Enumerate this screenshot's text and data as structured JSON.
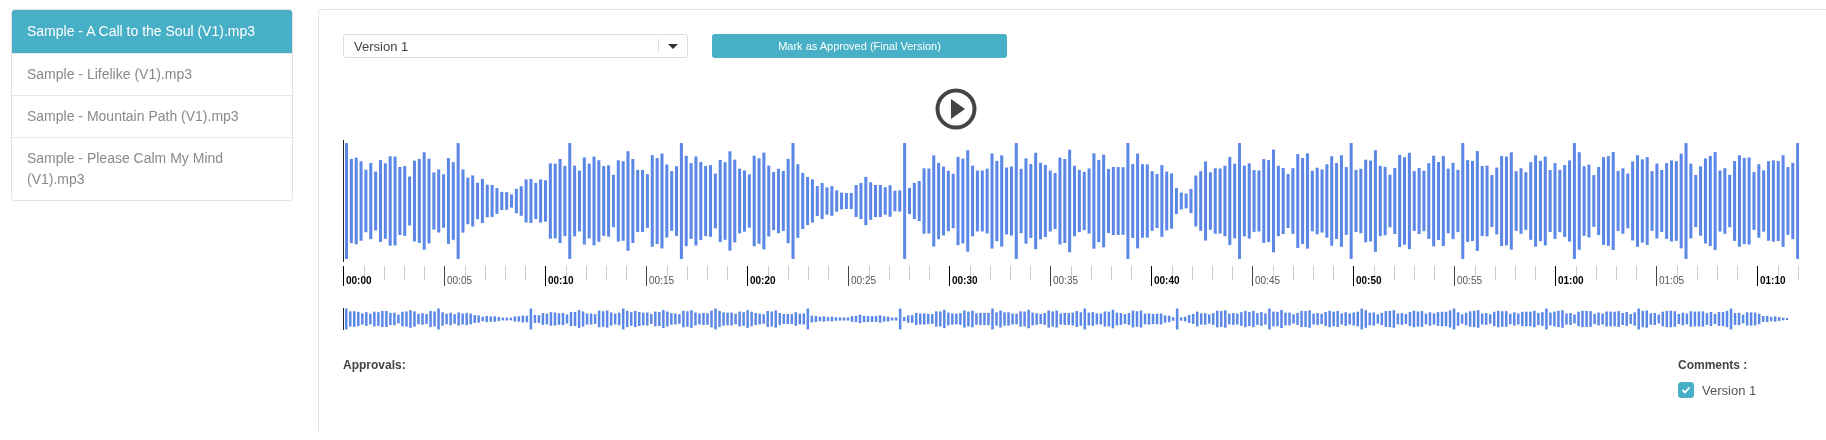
{
  "sidebar": {
    "items": [
      {
        "label": "Sample - A Call to the Soul (V1).mp3",
        "selected": true
      },
      {
        "label": "Sample - Lifelike (V1).mp3",
        "selected": false
      },
      {
        "label": "Sample - Mountain Path (V1).mp3",
        "selected": false
      },
      {
        "label": "Sample - Please Calm My Mind (V1).mp3",
        "selected": false
      }
    ]
  },
  "version_select": {
    "value": "Version 1"
  },
  "approve_button": "Mark as Approved (Final Version)",
  "timeline": [
    "00:00",
    "00:05",
    "00:10",
    "00:15",
    "00:20",
    "00:25",
    "00:30",
    "00:35",
    "00:40",
    "00:45",
    "00:50",
    "00:55",
    "01:00",
    "01:05",
    "01:10"
  ],
  "approvals_label": "Approvals:",
  "comments": {
    "label": "Comments :",
    "items": [
      {
        "label": "Version 1",
        "checked": true
      }
    ]
  }
}
